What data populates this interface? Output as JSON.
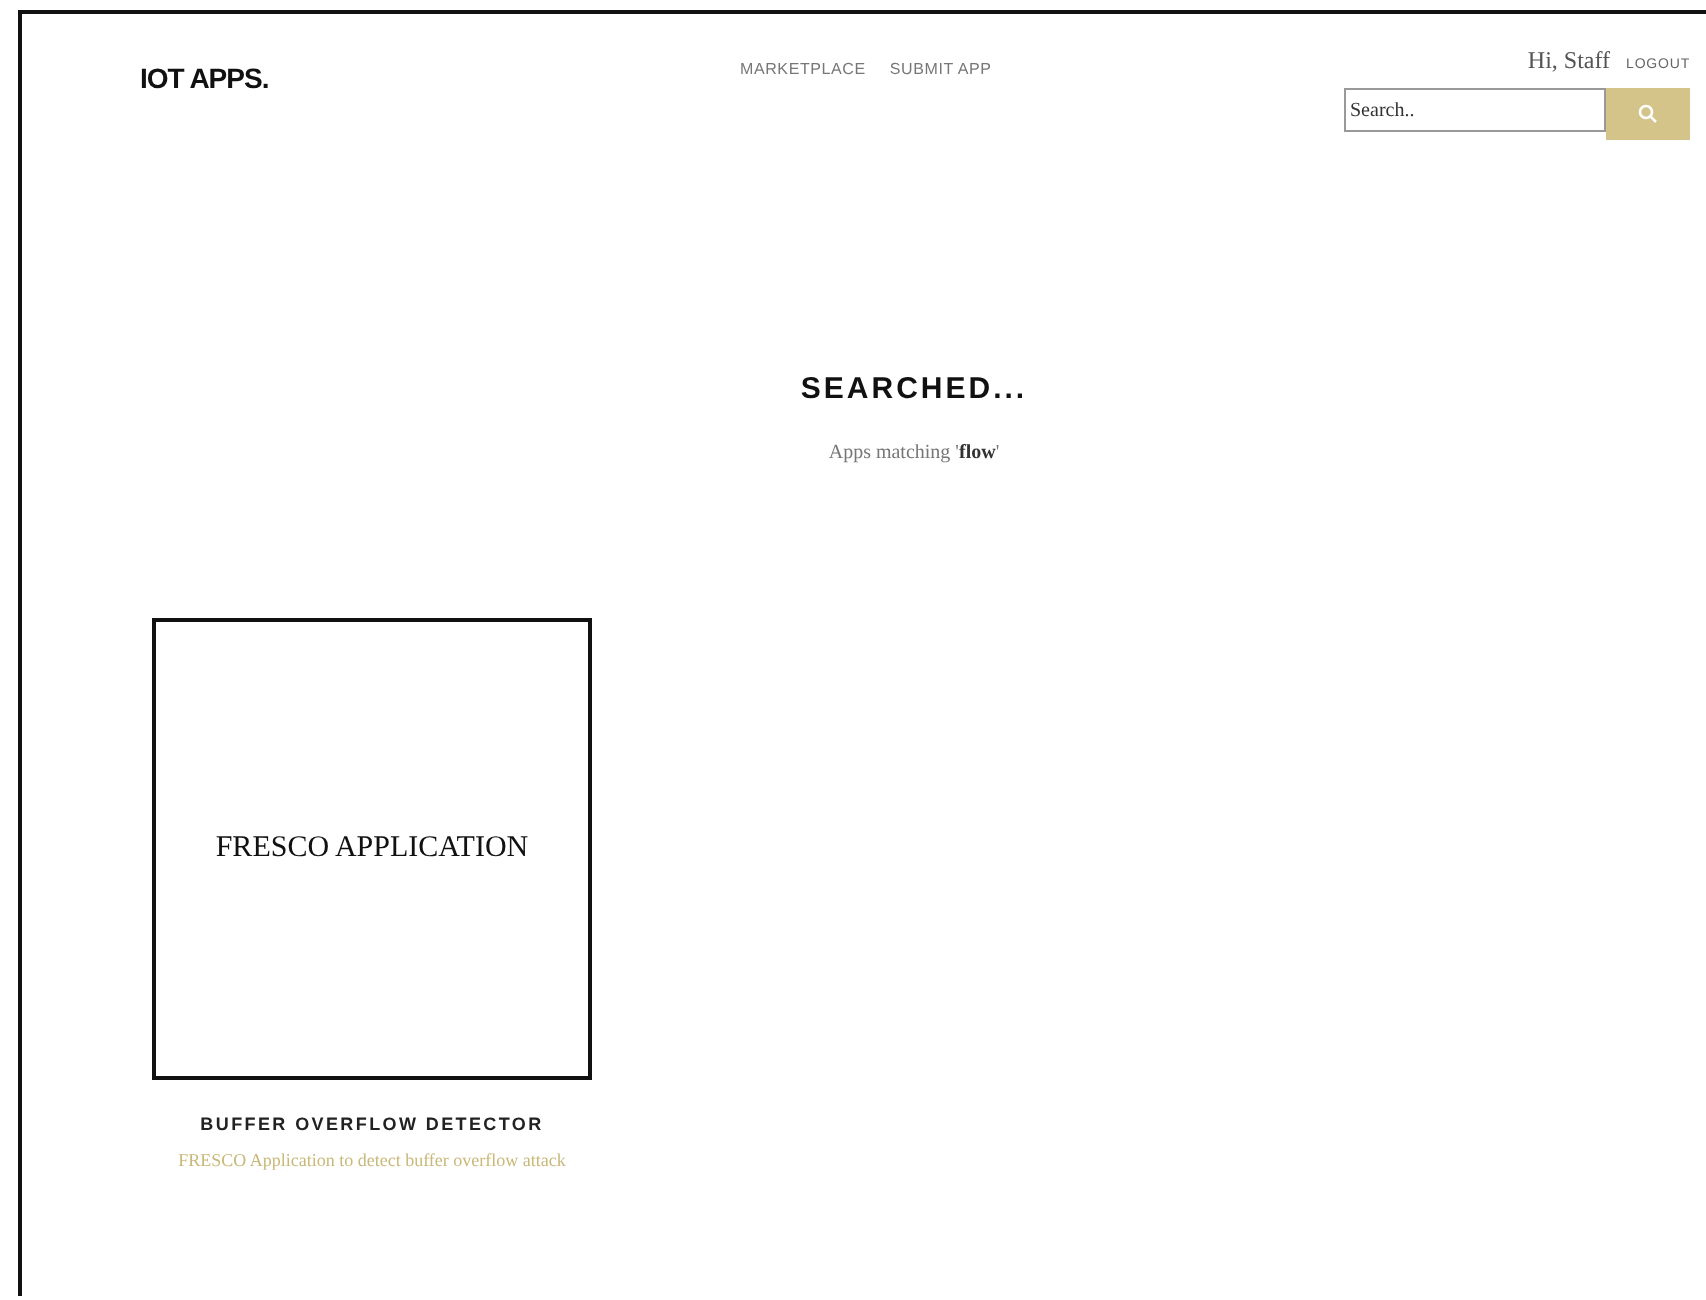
{
  "header": {
    "logo": "IOT APPS.",
    "nav": [
      "MARKETPLACE",
      "SUBMIT APP"
    ],
    "greeting": "Hi, Staff",
    "logout": "LOGOUT",
    "search": {
      "placeholder": "Search.."
    }
  },
  "results": {
    "title": "SEARCHED...",
    "subtitle": "Apps matching '**flow**'"
  },
  "apps": [
    {
      "image_text": "FRESCO APPLICATION",
      "name": "BUFFER OVERFLOW DETECTOR",
      "description": "FRESCO Application to detect buffer overflow attack"
    }
  ]
}
